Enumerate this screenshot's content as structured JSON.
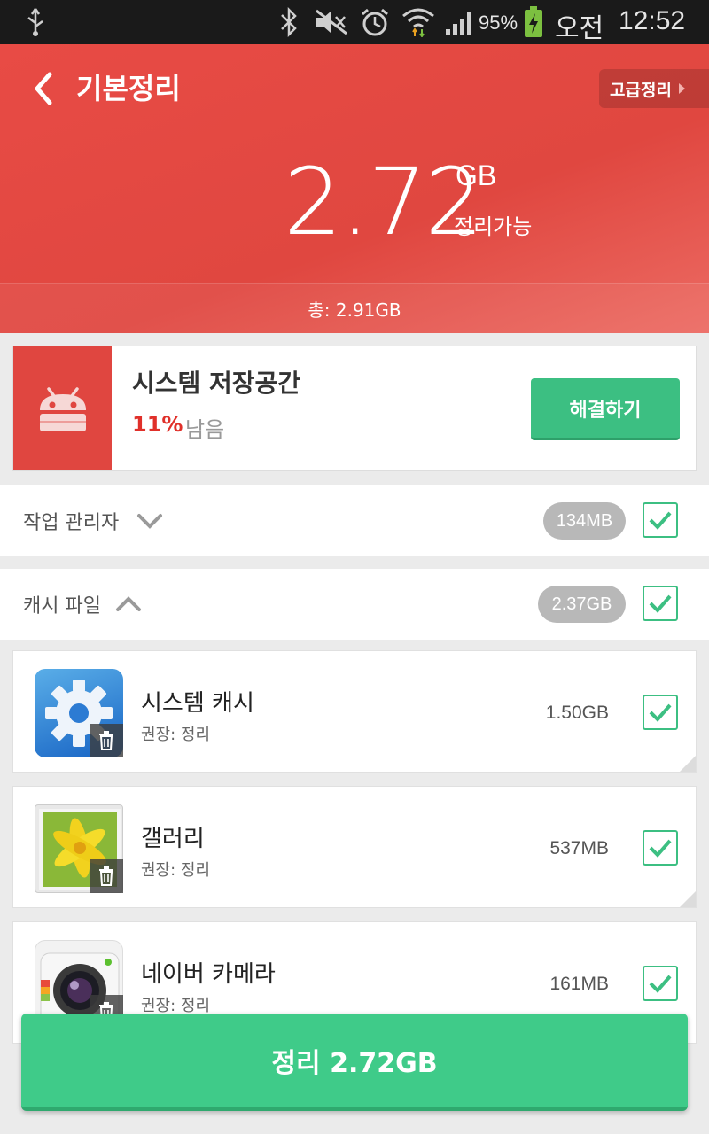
{
  "status_bar": {
    "battery_percent": "95%",
    "ampm": "오전",
    "time": "12:52",
    "icons": [
      "usb-icon",
      "bluetooth-icon",
      "mute-icon",
      "alarm-icon",
      "wifi-icon",
      "signal-icon",
      "battery-charging-icon"
    ]
  },
  "header": {
    "title": "기본정리",
    "advanced_label": "고급정리",
    "cleanable_value": "2.72",
    "cleanable_unit": "GB",
    "cleanable_caption": "정리가능",
    "total_label": "총: 2.91GB"
  },
  "storage": {
    "title": "시스템 저장공간",
    "percent": "11%",
    "remain_label": "남음",
    "fix_button": "해결하기"
  },
  "sections": [
    {
      "label": "작업 관리자",
      "size": "134MB",
      "expanded": false,
      "checked": true
    },
    {
      "label": "캐시 파일",
      "size": "2.37GB",
      "expanded": true,
      "checked": true
    }
  ],
  "apps": [
    {
      "name": "시스템 캐시",
      "sub": "권장: 정리",
      "size": "1.50GB",
      "icon": "settings-gear-icon",
      "checked": true
    },
    {
      "name": "갤러리",
      "sub": "권장: 정리",
      "size": "537MB",
      "icon": "gallery-flower-icon",
      "checked": true
    },
    {
      "name": "네이버 카메라",
      "sub": "권장: 정리",
      "size": "161MB",
      "icon": "camera-lens-icon",
      "checked": true
    }
  ],
  "clean_button": "정리 2.72GB",
  "colors": {
    "header_red": "#e04740",
    "accent_green": "#3cbf82",
    "warn_red": "#e0302a"
  }
}
